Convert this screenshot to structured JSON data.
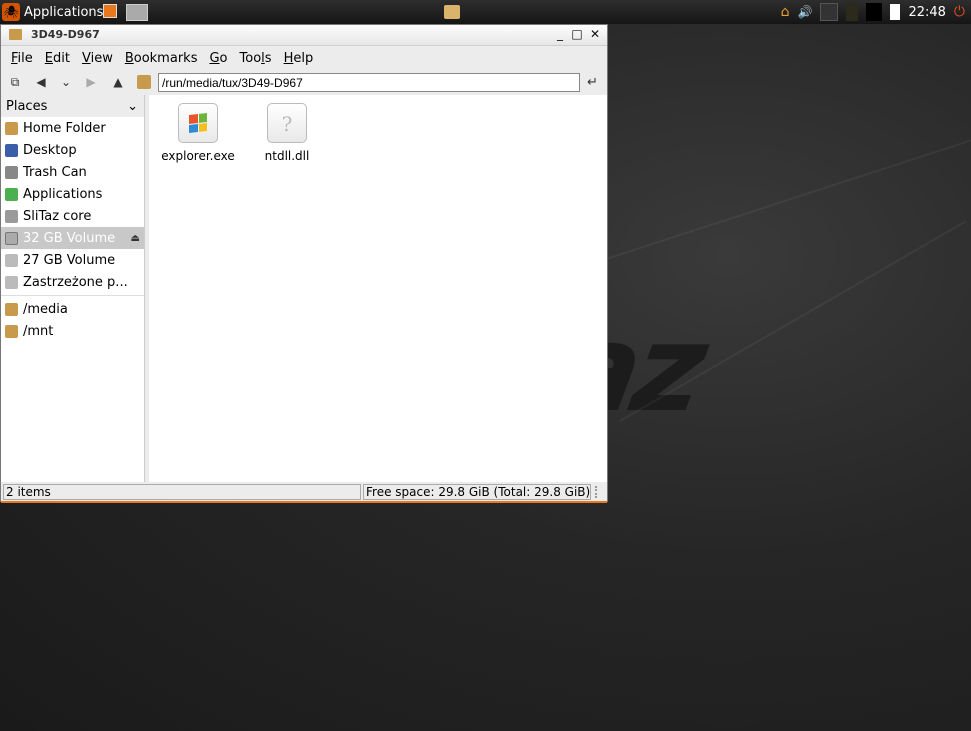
{
  "panel": {
    "apps_label": "Applications",
    "clock": "22:48"
  },
  "window": {
    "title": "3D49-D967",
    "controls": {
      "minimize": "_",
      "maximize": "□",
      "close": "✕"
    }
  },
  "menu": [
    {
      "prefix": "",
      "u": "F",
      "rest": "ile"
    },
    {
      "prefix": "",
      "u": "E",
      "rest": "dit"
    },
    {
      "prefix": "",
      "u": "V",
      "rest": "iew"
    },
    {
      "prefix": "",
      "u": "B",
      "rest": "ookmarks"
    },
    {
      "prefix": "",
      "u": "G",
      "rest": "o"
    },
    {
      "prefix": "Too",
      "u": "l",
      "rest": "s"
    },
    {
      "prefix": "",
      "u": "H",
      "rest": "elp"
    }
  ],
  "toolbar": {
    "path": "/run/media/tux/3D49-D967"
  },
  "sidebar": {
    "header": "Places",
    "items": [
      {
        "label": "Home Folder",
        "color": "#c89a4c"
      },
      {
        "label": "Desktop",
        "color": "#3a5fa8"
      },
      {
        "label": "Trash Can",
        "color": "#888888"
      },
      {
        "label": "Applications",
        "color": "#4caf50"
      },
      {
        "label": "SliTaz core",
        "color": "#9a9a9a"
      },
      {
        "label": "32 GB Volume",
        "color": "#aaaaaa",
        "selected": true
      },
      {
        "label": "27 GB Volume",
        "color": "#bbbbbb"
      },
      {
        "label": "Zastrzeżone p...",
        "color": "#bbbbbb"
      }
    ],
    "bookmarks": [
      {
        "label": "/media",
        "color": "#c89a4c"
      },
      {
        "label": "/mnt",
        "color": "#c89a4c"
      }
    ]
  },
  "files": [
    {
      "name": "explorer.exe",
      "icon": "windows-logo-icon"
    },
    {
      "name": "ntdll.dll",
      "icon": "unknown-file-icon"
    }
  ],
  "status": {
    "items": "2 items",
    "free_space": "Free space: 29.8 GiB (Total: 29.8 GiB)"
  },
  "colors": {
    "accent": "#e8781b",
    "selection": "#c8c8c8"
  }
}
